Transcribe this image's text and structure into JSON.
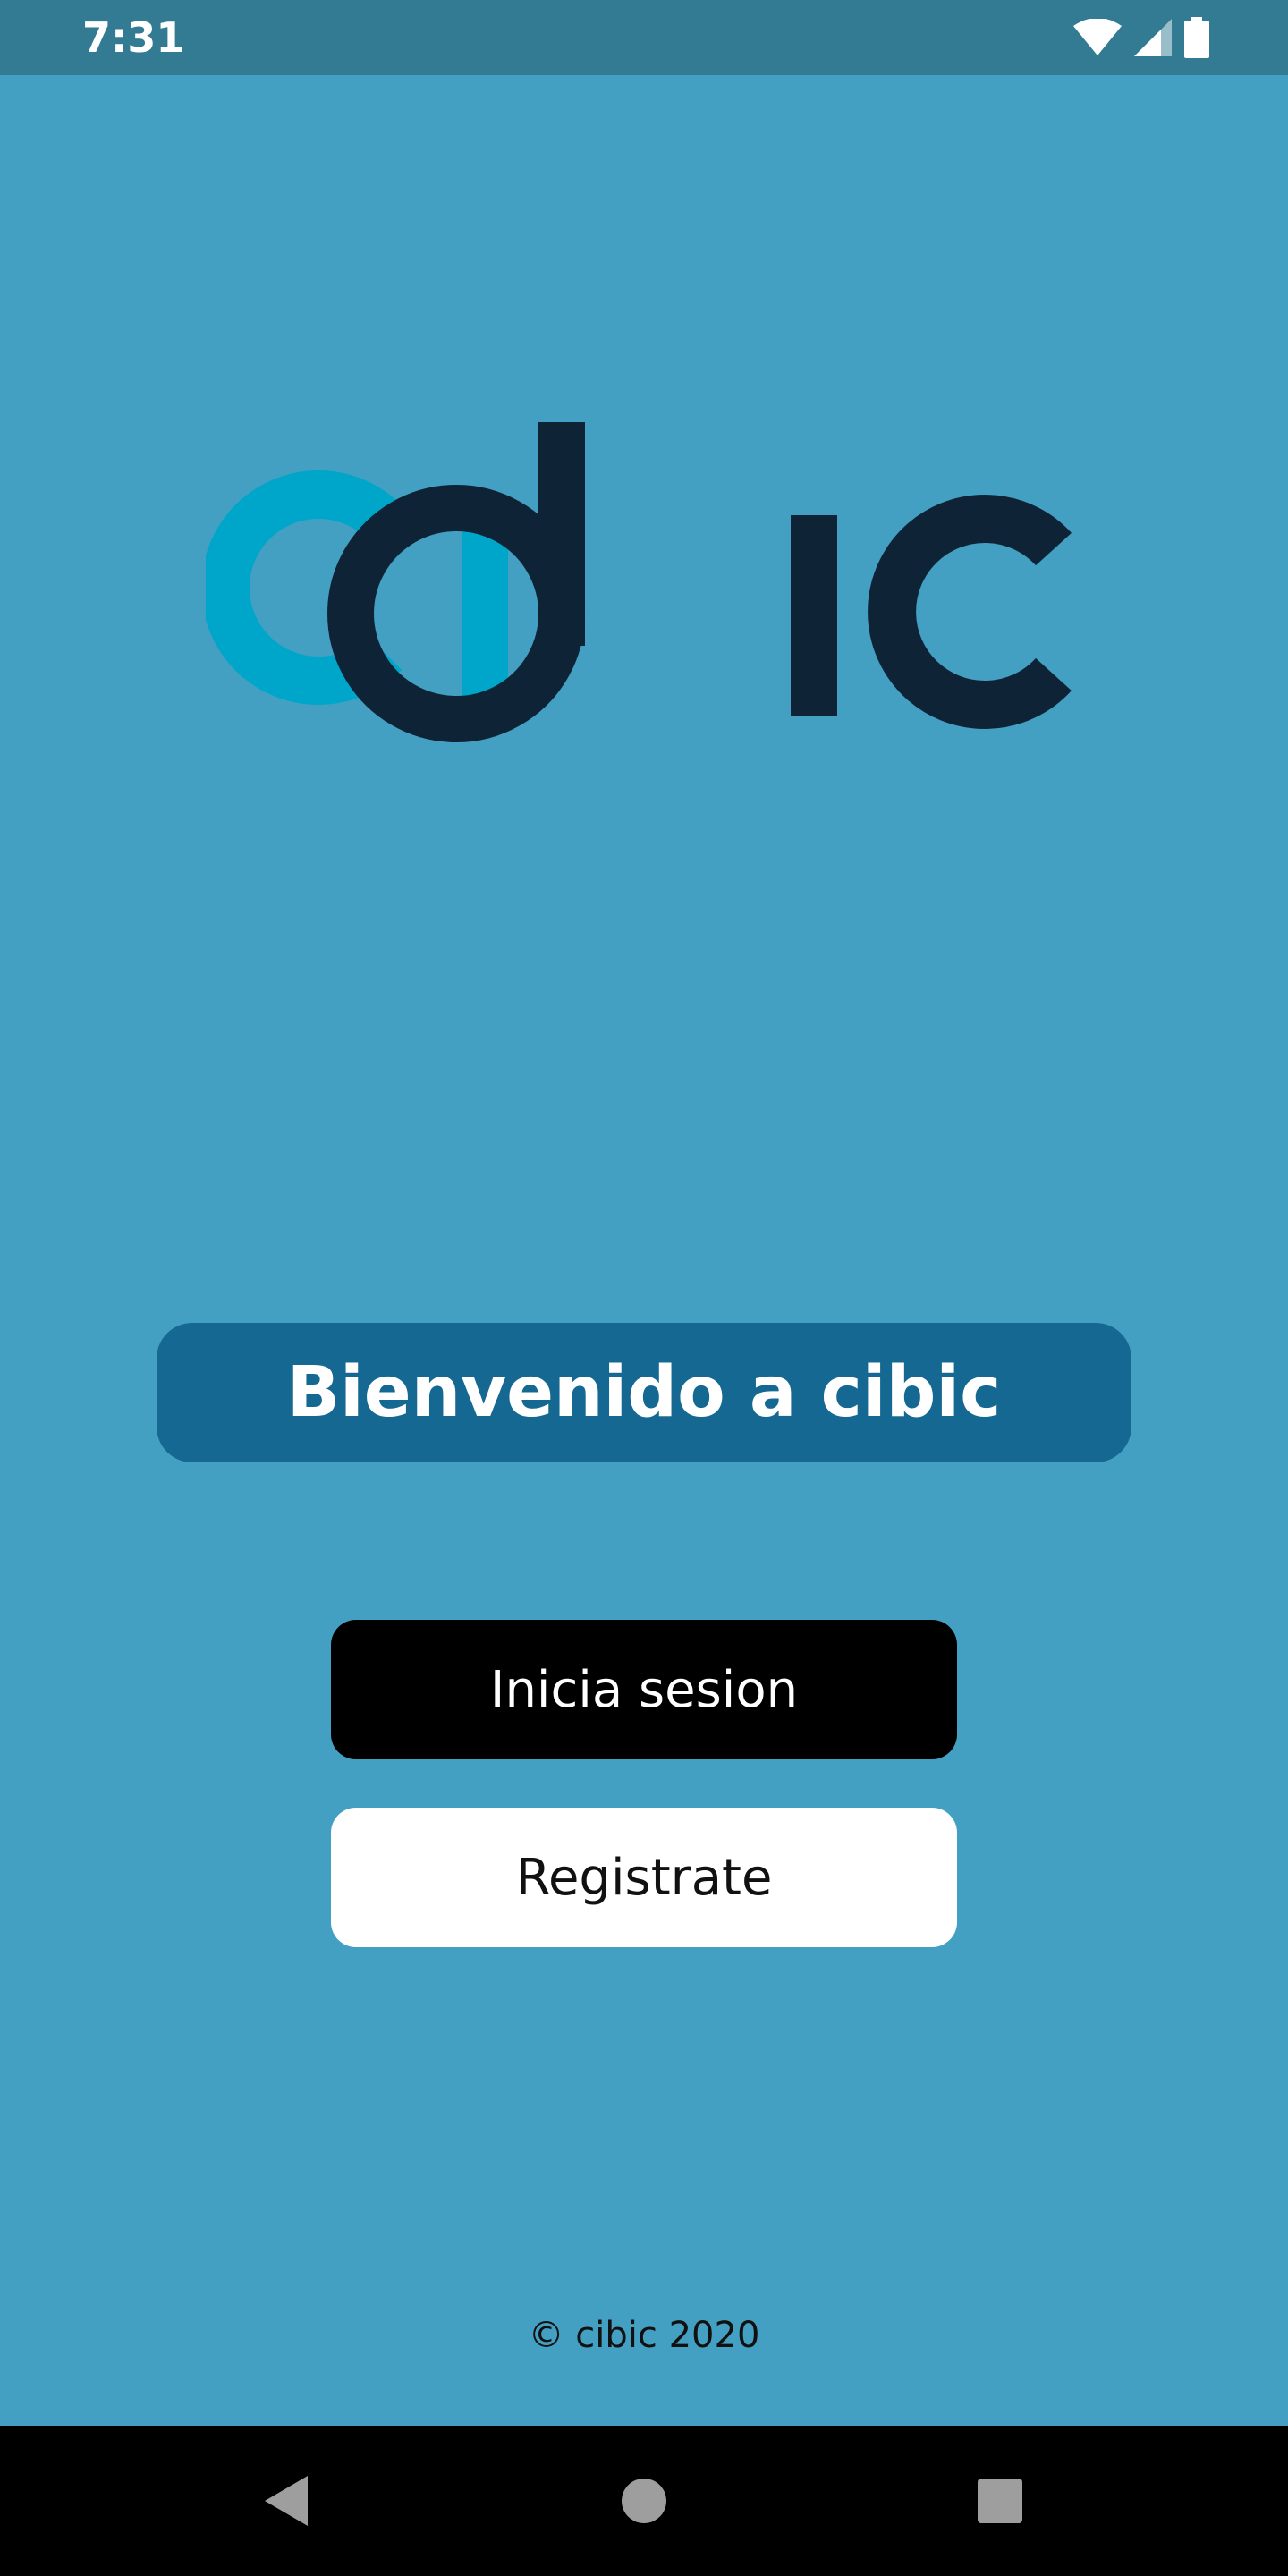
{
  "status_bar": {
    "time": "7:31",
    "icons": [
      "wifi-icon",
      "cellular-signal-icon",
      "battery-icon"
    ]
  },
  "brand": {
    "logo_text": "cibic",
    "logo_colors": {
      "light": "#00a6c9",
      "dark": "#0f2337"
    }
  },
  "welcome": {
    "title": "Bienvenido a cibic"
  },
  "actions": {
    "login_label": "Inicia sesion",
    "register_label": "Registrate"
  },
  "footer": {
    "copyright": "© cibic 2020"
  },
  "nav_bar": {
    "icons": [
      "back-icon",
      "home-icon",
      "recents-icon"
    ]
  },
  "colors": {
    "background": "#43a0c2",
    "status_bar": "#337a93",
    "banner": "#146892",
    "login_button": "#000000",
    "register_button": "#ffffff"
  }
}
